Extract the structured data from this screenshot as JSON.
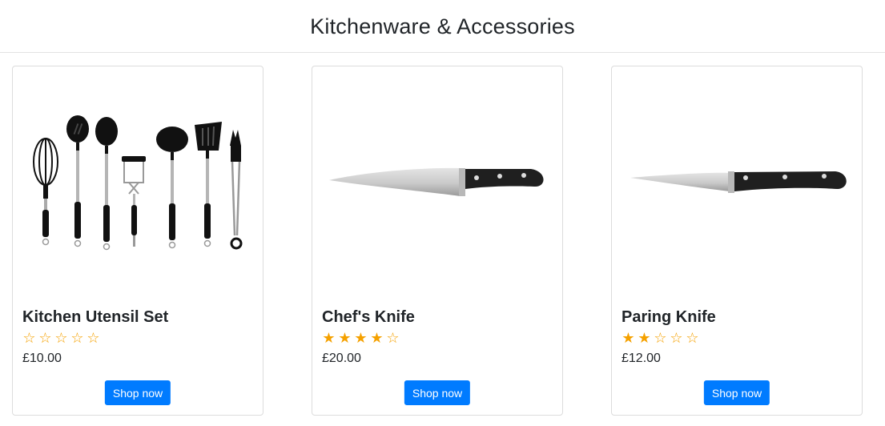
{
  "header": {
    "title": "Kitchenware & Accessories"
  },
  "colors": {
    "accent": "#007bff",
    "star": "#f5a100"
  },
  "products": [
    {
      "name": "Kitchen Utensil Set",
      "rating": 0,
      "max_rating": 5,
      "price": "£10.00",
      "button_label": "Shop now",
      "image_icon": "utensil-set-image"
    },
    {
      "name": "Chef's Knife",
      "rating": 4,
      "max_rating": 5,
      "price": "£20.00",
      "button_label": "Shop now",
      "image_icon": "chefs-knife-image"
    },
    {
      "name": "Paring Knife",
      "rating": 2,
      "max_rating": 5,
      "price": "£12.00",
      "button_label": "Shop now",
      "image_icon": "paring-knife-image"
    }
  ]
}
